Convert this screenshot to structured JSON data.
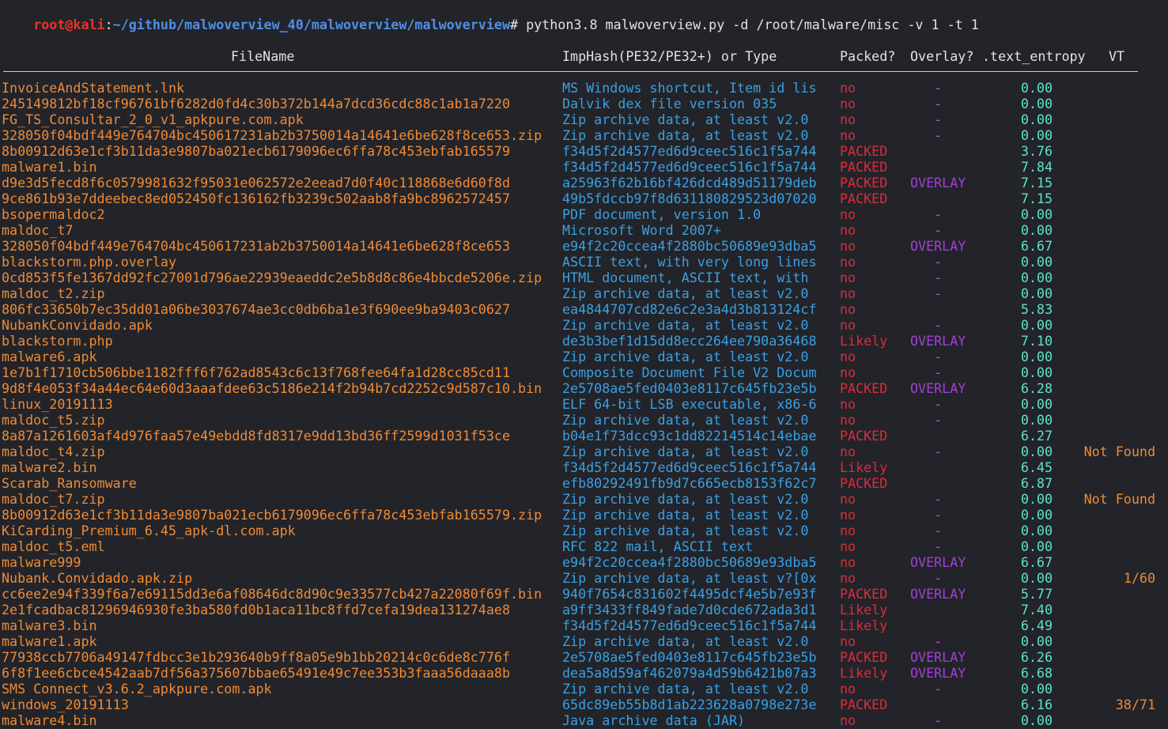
{
  "prompt": {
    "user": "root@kali",
    "sep": ":",
    "path": "~/github/malwoverview_40/malwoverview/malwoverview",
    "symbol": "#",
    "command": "python3.8 malwoverview.py -d /root/malware/misc -v 1 -t 1"
  },
  "headers": {
    "filename": "FileName",
    "imphash": "ImpHash(PE32/PE32+) or Type",
    "packed": "Packed?",
    "overlay": "Overlay?",
    "entropy": ".text_entropy",
    "vt": "VT"
  },
  "colors": {
    "filename": "#f08a35",
    "type": "#3aa0e2",
    "no": "#e02b3a",
    "packed": "#e02b3a",
    "likely": "#e02b3a",
    "overlay": "#a33fd4",
    "overlay_dash": "#c050c8",
    "entropy": "#5fe3c7",
    "vt": "#f08a35"
  },
  "rows": [
    {
      "file": "InvoiceAndStatement.lnk",
      "type": "MS Windows shortcut, Item id lis",
      "packed": "no",
      "overlay": "-",
      "entropy": "0.00",
      "vt": ""
    },
    {
      "file": "245149812bf18cf96761bf6282d0fd4c30b372b144a7dcd36cdc88c1ab1a7220",
      "type": "Dalvik dex file version 035",
      "packed": "no",
      "overlay": "-",
      "entropy": "0.00",
      "vt": ""
    },
    {
      "file": "FG_TS_Consultar_2_0_v1_apkpure.com.apk",
      "type": "Zip archive data, at least v2.0",
      "packed": "no",
      "overlay": "-",
      "entropy": "0.00",
      "vt": ""
    },
    {
      "file": "328050f04bdf449e764704bc450617231ab2b3750014a14641e6be628f8ce653.zip",
      "type": "Zip archive data, at least v2.0",
      "packed": "no",
      "overlay": "-",
      "entropy": "0.00",
      "vt": ""
    },
    {
      "file": "8b00912d63e1cf3b11da3e9807ba021ecb6179096ec6ffa78c453ebfab165579",
      "type": "f34d5f2d4577ed6d9ceec516c1f5a744",
      "packed": "PACKED",
      "overlay": "",
      "entropy": "3.76",
      "vt": ""
    },
    {
      "file": "malware1.bin",
      "type": "f34d5f2d4577ed6d9ceec516c1f5a744",
      "packed": "PACKED",
      "overlay": "",
      "entropy": "7.84",
      "vt": ""
    },
    {
      "file": "d9e3d5fecd8f6c0579981632f95031e062572e2eead7d0f40c118868e6d60f8d",
      "type": "a25963f62b16bf426dcd489d51179deb",
      "packed": "PACKED",
      "overlay": "OVERLAY",
      "entropy": "7.15",
      "vt": ""
    },
    {
      "file": "9ce861b93e7ddeebec8ed052450fc136162fb3239c502aab8fa9bc8962572457",
      "type": "49b5fdccb97f8d631180829523d07020",
      "packed": "PACKED",
      "overlay": "",
      "entropy": "7.15",
      "vt": ""
    },
    {
      "file": "bsopermaldoc2",
      "type": "PDF document, version 1.0",
      "packed": "no",
      "overlay": "-",
      "entropy": "0.00",
      "vt": ""
    },
    {
      "file": "maldoc_t7",
      "type": "Microsoft Word 2007+",
      "packed": "no",
      "overlay": "-",
      "entropy": "0.00",
      "vt": ""
    },
    {
      "file": "328050f04bdf449e764704bc450617231ab2b3750014a14641e6be628f8ce653",
      "type": "e94f2c20ccea4f2880bc50689e93dba5",
      "packed": "no",
      "overlay": "OVERLAY",
      "entropy": "6.67",
      "vt": ""
    },
    {
      "file": "blackstorm.php.overlay",
      "type": "ASCII text, with very long lines",
      "packed": "no",
      "overlay": "-",
      "entropy": "0.00",
      "vt": ""
    },
    {
      "file": "0cd853f5fe1367dd92fc27001d796ae22939eaeddc2e5b8d8c86e4bbcde5206e.zip",
      "type": "HTML document, ASCII text, with",
      "packed": "no",
      "overlay": "-",
      "entropy": "0.00",
      "vt": ""
    },
    {
      "file": "maldoc_t2.zip",
      "type": "Zip archive data, at least v2.0",
      "packed": "no",
      "overlay": "-",
      "entropy": "0.00",
      "vt": ""
    },
    {
      "file": "806fc33650b7ec35dd01a06be3037674ae3cc0db6ba1e3f690ee9ba9403c0627",
      "type": "ea4844707cd82e6c2e3a4d3b813124cf",
      "packed": "no",
      "overlay": "",
      "entropy": "5.83",
      "vt": ""
    },
    {
      "file": "NubankConvidado.apk",
      "type": "Zip archive data, at least v2.0",
      "packed": "no",
      "overlay": "-",
      "entropy": "0.00",
      "vt": ""
    },
    {
      "file": "blackstorm.php",
      "type": "de3b3bef1d15dd8ecc264ee790a36468",
      "packed": "Likely",
      "overlay": "OVERLAY",
      "entropy": "7.10",
      "vt": ""
    },
    {
      "file": "malware6.apk",
      "type": "Zip archive data, at least v2.0",
      "packed": "no",
      "overlay": "-",
      "entropy": "0.00",
      "vt": ""
    },
    {
      "file": "1e7b1f1710cb506bbe1182fff6f762ad8543c6c13f768fee64fa1d28cc85cd11",
      "type": "Composite Document File V2 Docum",
      "packed": "no",
      "overlay": "-",
      "entropy": "0.00",
      "vt": ""
    },
    {
      "file": "9d8f4e053f34a44ec64e60d3aaafdee63c5186e214f2b94b7cd2252c9d587c10.bin",
      "type": "2e5708ae5fed0403e8117c645fb23e5b",
      "packed": "PACKED",
      "overlay": "OVERLAY",
      "entropy": "6.28",
      "vt": ""
    },
    {
      "file": "linux_20191113",
      "type": "ELF 64-bit LSB executable, x86-6",
      "packed": "no",
      "overlay": "-",
      "entropy": "0.00",
      "vt": ""
    },
    {
      "file": "maldoc_t5.zip",
      "type": "Zip archive data, at least v2.0",
      "packed": "no",
      "overlay": "-",
      "entropy": "0.00",
      "vt": ""
    },
    {
      "file": "8a87a1261603af4d976faa57e49ebdd8fd8317e9dd13bd36ff2599d1031f53ce",
      "type": "b04e1f73dcc93c1dd82214514c14ebae",
      "packed": "PACKED",
      "overlay": "",
      "entropy": "6.27",
      "vt": ""
    },
    {
      "file": "maldoc_t4.zip",
      "type": "Zip archive data, at least v2.0",
      "packed": "no",
      "overlay": "-",
      "entropy": "0.00",
      "vt": "Not Found"
    },
    {
      "file": "malware2.bin",
      "type": "f34d5f2d4577ed6d9ceec516c1f5a744",
      "packed": "Likely",
      "overlay": "",
      "entropy": "6.45",
      "vt": ""
    },
    {
      "file": "Scarab_Ransomware",
      "type": "efb80292491fb9d7c665ecb8153f62c7",
      "packed": "PACKED",
      "overlay": "",
      "entropy": "6.87",
      "vt": ""
    },
    {
      "file": "maldoc_t7.zip",
      "type": "Zip archive data, at least v2.0",
      "packed": "no",
      "overlay": "-",
      "entropy": "0.00",
      "vt": "Not Found"
    },
    {
      "file": "8b00912d63e1cf3b11da3e9807ba021ecb6179096ec6ffa78c453ebfab165579.zip",
      "type": "Zip archive data, at least v2.0",
      "packed": "no",
      "overlay": "-",
      "entropy": "0.00",
      "vt": ""
    },
    {
      "file": "KiCarding_Premium_6.45_apk-dl.com.apk",
      "type": "Zip archive data, at least v2.0",
      "packed": "no",
      "overlay": "-",
      "entropy": "0.00",
      "vt": ""
    },
    {
      "file": "maldoc_t5.eml",
      "type": "RFC 822 mail, ASCII text",
      "packed": "no",
      "overlay": "-",
      "entropy": "0.00",
      "vt": ""
    },
    {
      "file": "malware999",
      "type": "e94f2c20ccea4f2880bc50689e93dba5",
      "packed": "no",
      "overlay": "OVERLAY",
      "entropy": "6.67",
      "vt": ""
    },
    {
      "file": "Nubank.Convidado.apk.zip",
      "type": "Zip archive data, at least v?[0x",
      "packed": "no",
      "overlay": "-",
      "entropy": "0.00",
      "vt": "1/60"
    },
    {
      "file": "cc6ee2e94f339f6a7e69115dd3e6af08646dc8d90c9e33577cb427a22080f69f.bin",
      "type": "940f7654c831602f4495dcf4e5b7e93f",
      "packed": "PACKED",
      "overlay": "OVERLAY",
      "entropy": "5.77",
      "vt": ""
    },
    {
      "file": "2e1fcadbac81296946930fe3ba580fd0b1aca11bc8ffd7cefa19dea131274ae8",
      "type": "a9ff3433ff849fade7d0cde672ada3d1",
      "packed": "Likely",
      "overlay": "",
      "entropy": "7.40",
      "vt": ""
    },
    {
      "file": "malware3.bin",
      "type": "f34d5f2d4577ed6d9ceec516c1f5a744",
      "packed": "Likely",
      "overlay": "",
      "entropy": "6.49",
      "vt": ""
    },
    {
      "file": "malware1.apk",
      "type": "Zip archive data, at least v2.0",
      "packed": "no",
      "overlay": "-",
      "entropy": "0.00",
      "vt": ""
    },
    {
      "file": "77938ccb7706a49147fdbcc3e1b293640b9ff8a05e9b1bb20214c0c6de8c776f",
      "type": "2e5708ae5fed0403e8117c645fb23e5b",
      "packed": "PACKED",
      "overlay": "OVERLAY",
      "entropy": "6.26",
      "vt": ""
    },
    {
      "file": "6f8f1ee6cbce4542aab7df56a375607bbae65491e49c7ee353b3faaa56daaa8b",
      "type": "dea5a8d59af462079a4d59b6421b07a3",
      "packed": "Likely",
      "overlay": "OVERLAY",
      "entropy": "6.68",
      "vt": ""
    },
    {
      "file": "SMS Connect_v3.6.2_apkpure.com.apk",
      "type": "Zip archive data, at least v2.0",
      "packed": "no",
      "overlay": "-",
      "entropy": "0.00",
      "vt": ""
    },
    {
      "file": "windows_20191113",
      "type": "65dc89eb55b8d1ab223628a0798e273e",
      "packed": "PACKED",
      "overlay": "",
      "entropy": "6.16",
      "vt": "38/71"
    },
    {
      "file": "malware4.bin",
      "type": "Java archive data (JAR)",
      "packed": "no",
      "overlay": "-",
      "entropy": "0.00",
      "vt": ""
    }
  ]
}
